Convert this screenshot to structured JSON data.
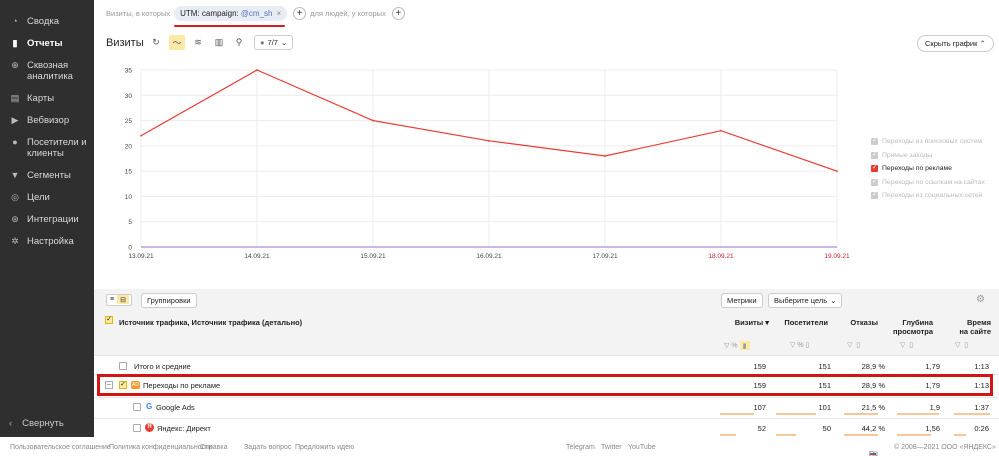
{
  "sidebar": {
    "items": [
      {
        "label": "Сводка",
        "icon": "dashboard-icon"
      },
      {
        "label": "Отчеты",
        "icon": "reports-icon",
        "active": true
      },
      {
        "label": "Сквозная аналитика",
        "icon": "end-to-end-icon"
      },
      {
        "label": "Карты",
        "icon": "map-icon"
      },
      {
        "label": "Вебвизор",
        "icon": "play-icon"
      },
      {
        "label": "Посетители и клиенты",
        "icon": "person-icon"
      },
      {
        "label": "Сегменты",
        "icon": "filter-icon"
      },
      {
        "label": "Цели",
        "icon": "target-icon"
      },
      {
        "label": "Интеграции",
        "icon": "integration-icon"
      },
      {
        "label": "Настройка",
        "icon": "gear-icon"
      }
    ],
    "collapse_label": "Свернуть"
  },
  "filterbar": {
    "prefix": "Визиты, в которых",
    "chip_key": "UTM: campaign:",
    "chip_value": "@cm_sh",
    "middle": "для людей, у которых"
  },
  "chart_toolbar": {
    "title": "Визиты",
    "series_count": "7/7",
    "hide_chart": "Скрыть график"
  },
  "chart_data": {
    "type": "line",
    "x": [
      "13.09.21",
      "14.09.21",
      "15.09.21",
      "16.09.21",
      "17.09.21",
      "18.09.21",
      "19.09.21"
    ],
    "weekend_x": [
      "18.09.21",
      "19.09.21"
    ],
    "series": [
      {
        "name": "Переходы по рекламе",
        "values": [
          22,
          35,
          25,
          21,
          18,
          23,
          15
        ],
        "color": "#e83b34"
      }
    ],
    "ylim": [
      0,
      35
    ],
    "yticks": [
      "0",
      "5",
      "10",
      "15",
      "20",
      "25",
      "30",
      "35"
    ],
    "grid": true
  },
  "legend": [
    {
      "label": "Переходы из поисковых систем",
      "on": false
    },
    {
      "label": "Прямые заходы",
      "on": false
    },
    {
      "label": "Переходы по рекламе",
      "on": true
    },
    {
      "label": "Переходы по ссылкам на сайтах",
      "on": false
    },
    {
      "label": "Переходы из социальных сетей",
      "on": false
    }
  ],
  "table_toolbar": {
    "groupings": "Группировки",
    "metrics": "Метрики",
    "goal": "Выберите цель"
  },
  "table": {
    "dimension_header": "Источник трафика, Источник трафика (детально)",
    "columns": [
      "Визиты",
      "Посетители",
      "Отказы",
      "Глубина просмотра",
      "Время на сайте"
    ],
    "col_lines": [
      [
        "Визиты"
      ],
      [
        "Посетители"
      ],
      [
        "Отказы"
      ],
      [
        "Глубина",
        "просмотра"
      ],
      [
        "Время",
        "на сайте"
      ]
    ],
    "rows": [
      {
        "label": "Итого и средние",
        "values": [
          "159",
          "151",
          "28,9 %",
          "1,79",
          "1:13"
        ]
      },
      {
        "label": "Переходы по рекламе",
        "values": [
          "159",
          "151",
          "28,9 %",
          "1,79",
          "1:13"
        ]
      },
      {
        "label": "Google Ads",
        "values": [
          "107",
          "101",
          "21,5 %",
          "1,9",
          "1:37"
        ]
      },
      {
        "label": "Яндекс: Директ",
        "values": [
          "52",
          "50",
          "44,2 %",
          "1,56",
          "0:26"
        ]
      }
    ]
  },
  "footer": {
    "links": [
      "Пользовательское соглашение",
      "Политика конфиденциальности",
      "Справка",
      "Задать вопрос",
      "Предложить идею"
    ],
    "social": [
      "Telegram",
      "Twitter",
      "YouTube"
    ],
    "lang": "Ru",
    "copyright": "© 2008—2021 ООО «ЯНДЕКС»"
  }
}
